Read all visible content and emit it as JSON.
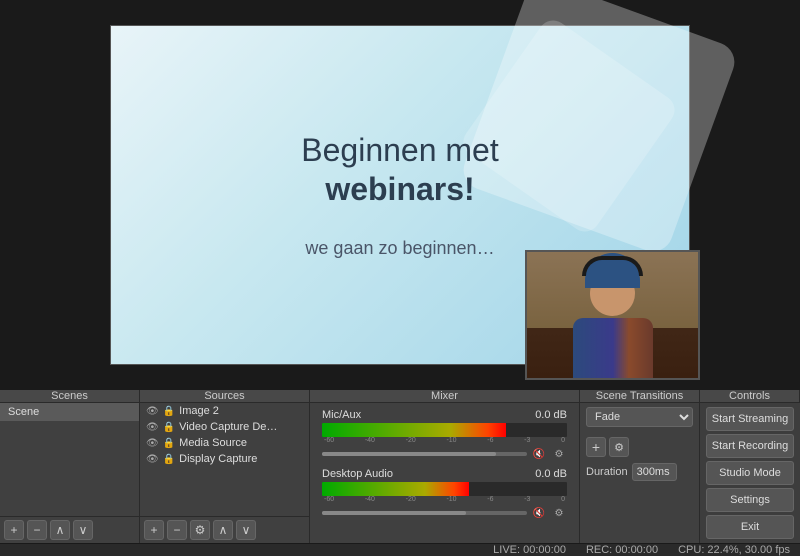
{
  "preview": {
    "slide": {
      "title_line1": "Beginnen met",
      "title_line2": "webinars!",
      "subtitle": "we gaan zo beginnen…"
    }
  },
  "panels": {
    "scenes_header": "Scenes",
    "sources_header": "Sources",
    "mixer_header": "Mixer",
    "transitions_header": "Scene Transitions",
    "controls_header": "Controls"
  },
  "scenes": {
    "items": [
      {
        "label": "Scene"
      }
    ]
  },
  "sources": {
    "items": [
      {
        "label": "Image 2"
      },
      {
        "label": "Video Capture De…"
      },
      {
        "label": "Media Source"
      },
      {
        "label": "Display Capture"
      }
    ]
  },
  "mixer": {
    "channels": [
      {
        "name": "Mic/Aux",
        "db": "0.0 dB",
        "level": 75
      },
      {
        "name": "Desktop Audio",
        "db": "0.0 dB",
        "level": 60
      }
    ],
    "db_labels": [
      "-60",
      "-40",
      "-20",
      "-10",
      "-6",
      "-3",
      "0"
    ]
  },
  "transitions": {
    "selected": "Fade",
    "duration_label": "Duration",
    "duration_value": "300ms"
  },
  "controls": {
    "buttons": [
      {
        "label": "Start Streaming"
      },
      {
        "label": "Start Recording"
      },
      {
        "label": "Studio Mode"
      },
      {
        "label": "Settings"
      },
      {
        "label": "Exit"
      }
    ]
  },
  "statusbar": {
    "live": "LIVE: 00:00:00",
    "rec": "REC: 00:00:00",
    "cpu": "CPU: 22.4%, 30.00 fps"
  }
}
